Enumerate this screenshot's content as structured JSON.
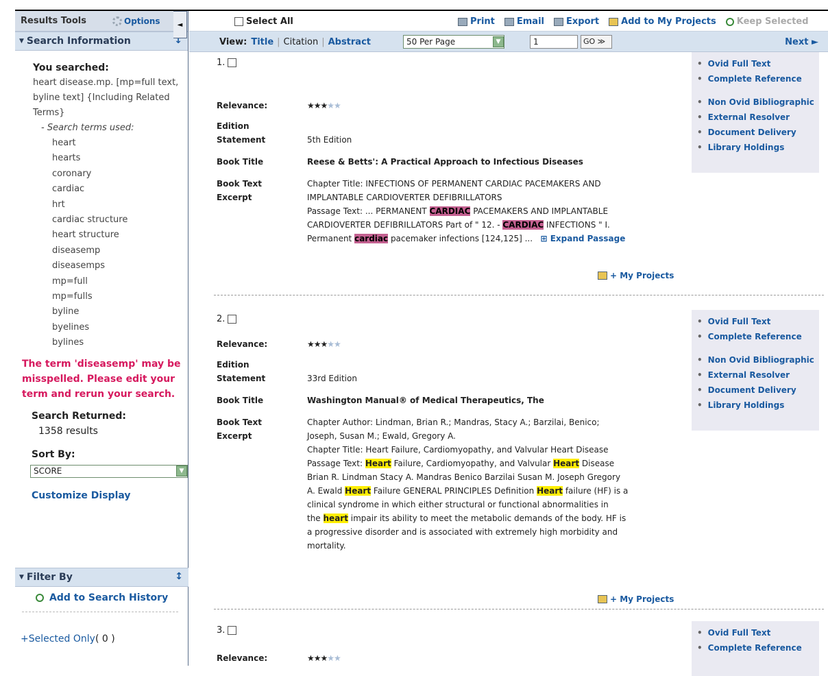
{
  "sidebar": {
    "results_tools": "Results Tools",
    "options": "Options",
    "search_info_title": "Search Information",
    "you_searched_label": "You searched:",
    "query": "heart disease.mp. [mp=full text, byline text] {Including Related Terms}",
    "terms_used_label": "- Search terms used:",
    "terms": [
      "heart",
      "hearts",
      "coronary",
      "cardiac",
      "hrt",
      "cardiac structure",
      "heart structure",
      "diseasemp",
      "diseasemps",
      "mp=full",
      "mp=fulls",
      "byline",
      "byelines",
      "bylines"
    ],
    "warning": "The term 'diseasemp' may be misspelled.  Please edit your term and rerun your search.",
    "search_returned_label": "Search Returned:",
    "search_returned_value": "1358 results",
    "sort_by_label": "Sort By:",
    "sort_by_value": "SCORE",
    "customize": "Customize Display",
    "filter_by": "Filter By",
    "add_history": "Add to Search History",
    "selected_only": "+Selected Only",
    "selected_count": "( 0 )"
  },
  "toolbar": {
    "select_all": "Select All",
    "print": "Print",
    "email": "Email",
    "export": "Export",
    "add_projects": "Add to My Projects",
    "keep_selected": "Keep Selected"
  },
  "viewbar": {
    "view_label": "View:",
    "title": "Title",
    "citation": "Citation",
    "abstract": "Abstract",
    "per_page": "50 Per Page",
    "page": "1",
    "go": "GO ≫",
    "next": "Next ►"
  },
  "labels": {
    "relevance": "Relevance:",
    "edition_1": "Edition",
    "edition_2": "Statement",
    "book_title": "Book Title",
    "excerpt_1": "Book Text",
    "excerpt_2": "Excerpt",
    "my_projects": "+ My Projects",
    "expand": "Expand Passage"
  },
  "links": {
    "ovid": "Ovid Full Text",
    "complete": "Complete Reference",
    "nonovid": "Non Ovid Bibliographic",
    "resolver": "External Resolver",
    "delivery": "Document Delivery",
    "holdings": "Library Holdings"
  },
  "results": [
    {
      "num": "1.",
      "relevance_stars": 3,
      "edition": "5th Edition",
      "book_title": "Reese & Betts': A Practical Approach to Infectious Diseases",
      "l1": "Chapter Title: INFECTIONS OF PERMANENT CARDIAC PACEMAKERS AND",
      "l2": "IMPLANTABLE CARDIOVERTER DEFIBRILLATORS",
      "l3a": "Passage Text: ... PERMANENT ",
      "l3h": "CARDIAC",
      "l3b": " PACEMAKERS AND IMPLANTABLE",
      "l4a": "CARDIOVERTER DEFIBRILLATORS Part of \" 12. - ",
      "l4h": "CARDIAC",
      "l4b": " INFECTIONS \" I.",
      "l5a": "Permanent ",
      "l5h": "cardiac",
      "l5b": " pacemaker infections [124,125] ..."
    },
    {
      "num": "2.",
      "relevance_stars": 3,
      "edition": "33rd Edition",
      "book_title": "Washington Manual® of Medical Therapeutics, The",
      "l1": "Chapter Author: Lindman, Brian R.; Mandras, Stacy A.; Barzilai, Benico;",
      "l2": "Joseph, Susan M.; Ewald, Gregory A.",
      "l3": "Chapter Title: Heart Failure, Cardiomyopathy, and Valvular Heart Disease",
      "l4a": "Passage Text: ",
      "h": "Heart",
      "l4b": " Failure, Cardiomyopathy, and Valvular ",
      "l4c": " Disease",
      "l5": "Brian R. Lindman Stacy A. Mandras Benico Barzilai Susan M. Joseph Gregory",
      "l6a": "A. Ewald ",
      "l6b": " Failure GENERAL PRINCIPLES Definition ",
      "l6c": " failure (HF) is a",
      "l7": "clinical syndrome in which either structural or functional abnormalities in",
      "l8a": "the ",
      "h2": "heart",
      "l8b": " impair its ability to meet the metabolic demands of the body. HF is",
      "l9": "a progressive disorder and is associated with extremely high morbidity and",
      "l10": "mortality."
    },
    {
      "num": "3.",
      "relevance_stars": 3
    }
  ]
}
